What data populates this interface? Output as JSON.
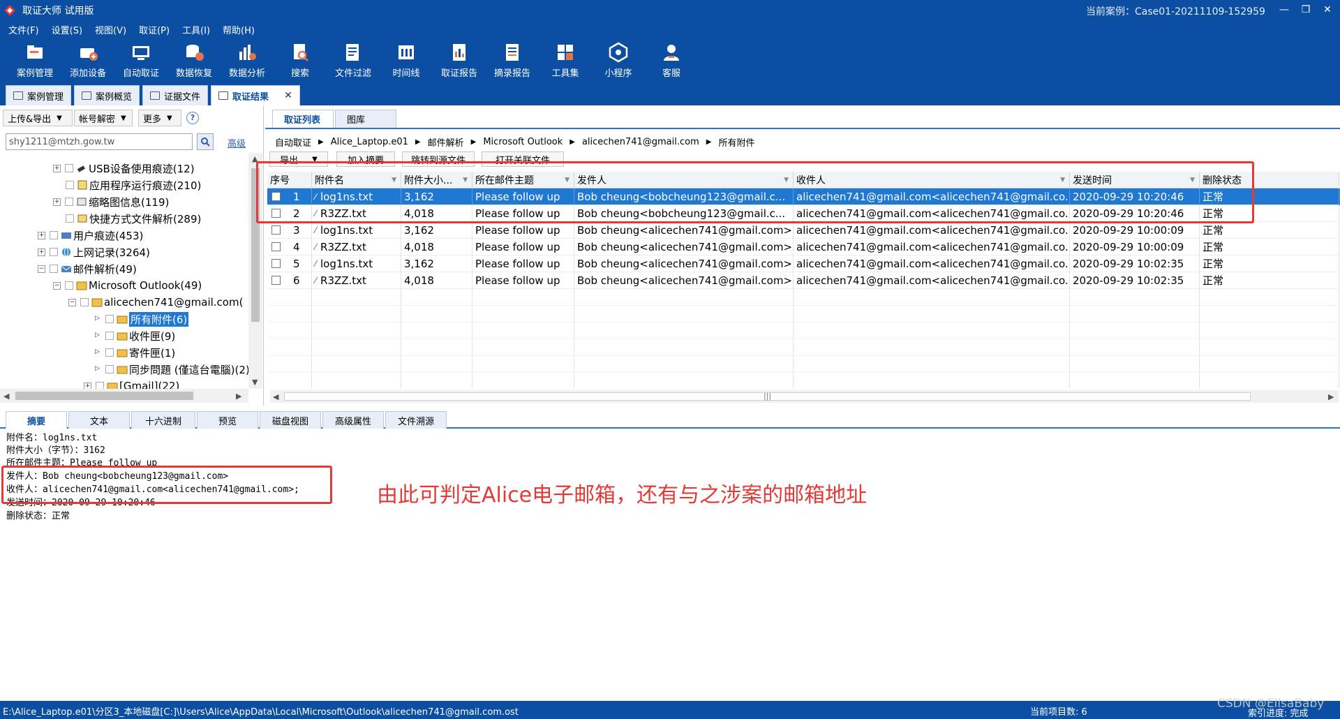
{
  "window": {
    "title": "取证大师 试用版",
    "current_case": "当前案例：Case01-20211109-152959",
    "min": "—",
    "restore": "❐",
    "close": "✕"
  },
  "menu": [
    "文件(F)",
    "设置(S)",
    "视图(V)",
    "取证(P)",
    "工具(I)",
    "帮助(H)"
  ],
  "toolbar": [
    {
      "label": "案例管理",
      "icon": "case-manage-icon"
    },
    {
      "label": "添加设备",
      "icon": "add-device-icon"
    },
    {
      "label": "自动取证",
      "icon": "auto-forensics-icon"
    },
    {
      "label": "数据恢复",
      "icon": "data-recovery-icon"
    },
    {
      "label": "数据分析",
      "icon": "data-analysis-icon"
    },
    {
      "label": "搜索",
      "icon": "search-doc-icon"
    },
    {
      "label": "文件过滤",
      "icon": "file-filter-icon"
    },
    {
      "label": "时间线",
      "icon": "timeline-icon"
    },
    {
      "label": "取证报告",
      "icon": "report-icon"
    },
    {
      "label": "摘录报告",
      "icon": "excerpt-report-icon"
    },
    {
      "label": "工具集",
      "icon": "toolset-icon"
    },
    {
      "label": "小程序",
      "icon": "miniprogram-icon"
    },
    {
      "label": "客服",
      "icon": "customer-service-icon"
    }
  ],
  "module_tabs": [
    "案例管理",
    "案例概览",
    "证据文件",
    "取证结果"
  ],
  "left": {
    "upload_export": "上传&导出",
    "account_decrypt": "帐号解密",
    "more": "更多",
    "help": "?",
    "search_value": "shy1211@mtzh.gow.tw",
    "advanced": "高级",
    "tree": [
      "USB设备使用痕迹(12)",
      "应用程序运行痕迹(210)",
      "缩略图信息(119)",
      "快捷方式文件解析(289)",
      "用户痕迹(453)",
      "上网记录(3264)",
      "邮件解析(49)",
      "Microsoft Outlook(49)",
      "alicechen741@gmail.com(",
      "所有附件(6)",
      "收件匣(9)",
      "寄件匣(1)",
      "同步問題 (僅這台電腦)(2)",
      "[Gmail](22)"
    ]
  },
  "right": {
    "tabs": [
      "取证列表",
      "图库"
    ],
    "breadcrumb": [
      "自动取证",
      "Alice_Laptop.e01",
      "邮件解析",
      "Microsoft Outlook",
      "alicechen741@gmail.com",
      "所有附件"
    ],
    "actions": [
      "导出",
      "加入摘要",
      "跳转到源文件",
      "打开关联文件"
    ],
    "columns": [
      "序号",
      "附件名",
      "附件大小...",
      "所在邮件主题",
      "发件人",
      "收件人",
      "发送时间",
      "删除状态"
    ],
    "rows": [
      [
        "1",
        "log1ns.txt",
        "3,162",
        "Please follow up",
        "Bob cheung<bobcheung123@gmail.c...",
        "alicechen741@gmail.com<alicechen741@gmail.co...",
        "2020-09-29 10:20:46",
        "正常"
      ],
      [
        "2",
        "R3ZZ.txt",
        "4,018",
        "Please follow up",
        "Bob cheung<bobcheung123@gmail.c...",
        "alicechen741@gmail.com<alicechen741@gmail.co...",
        "2020-09-29 10:20:46",
        "正常"
      ],
      [
        "3",
        "log1ns.txt",
        "3,162",
        "Please follow up",
        "Bob cheung<alicechen741@gmail.com>",
        "alicechen741@gmail.com<alicechen741@gmail.co...",
        "2020-09-29 10:00:09",
        "正常"
      ],
      [
        "4",
        "R3ZZ.txt",
        "4,018",
        "Please follow up",
        "Bob cheung<alicechen741@gmail.com>",
        "alicechen741@gmail.com<alicechen741@gmail.co...",
        "2020-09-29 10:00:09",
        "正常"
      ],
      [
        "5",
        "log1ns.txt",
        "3,162",
        "Please follow up",
        "Bob cheung<alicechen741@gmail.com>",
        "alicechen741@gmail.com<alicechen741@gmail.co...",
        "2020-09-29 10:02:35",
        "正常"
      ],
      [
        "6",
        "R3ZZ.txt",
        "4,018",
        "Please follow up",
        "Bob cheung<alicechen741@gmail.com>",
        "alicechen741@gmail.com<alicechen741@gmail.co...",
        "2020-09-29 10:02:35",
        "正常"
      ]
    ],
    "selected_row": 0
  },
  "detail": {
    "tabs": [
      "摘要",
      "文本",
      "十六进制",
      "预览",
      "磁盘视图",
      "高级属性",
      "文件溯源"
    ],
    "lines": [
      "附件名：log1ns.txt",
      "附件大小（字节）：3162",
      "所在邮件主题：Please follow up",
      "发件人：Bob cheung<bobcheung123@gmail.com>",
      "收件人：alicechen741@gmail.com<alicechen741@gmail.com>;",
      "发送时间：2020-09-29 10:20:46",
      "删除状态：正常"
    ],
    "annotation": "由此可判定Alice电子邮箱，还有与之涉案的邮箱地址"
  },
  "status": {
    "path": "E:\\Alice_Laptop.e01\\分区3_本地磁盘[C:]\\Users\\Alice\\AppData\\Local\\Microsoft\\Outlook\\alicechen741@gmail.com.ost",
    "count": "当前项目数: 6",
    "index": "索引进度: 完成",
    "watermark": "CSDN @EllsaBaby"
  },
  "colors": {
    "chrome_blue": "#0b4ea2",
    "selection_blue": "#1f78d1",
    "highlight_red": "#e53935"
  }
}
